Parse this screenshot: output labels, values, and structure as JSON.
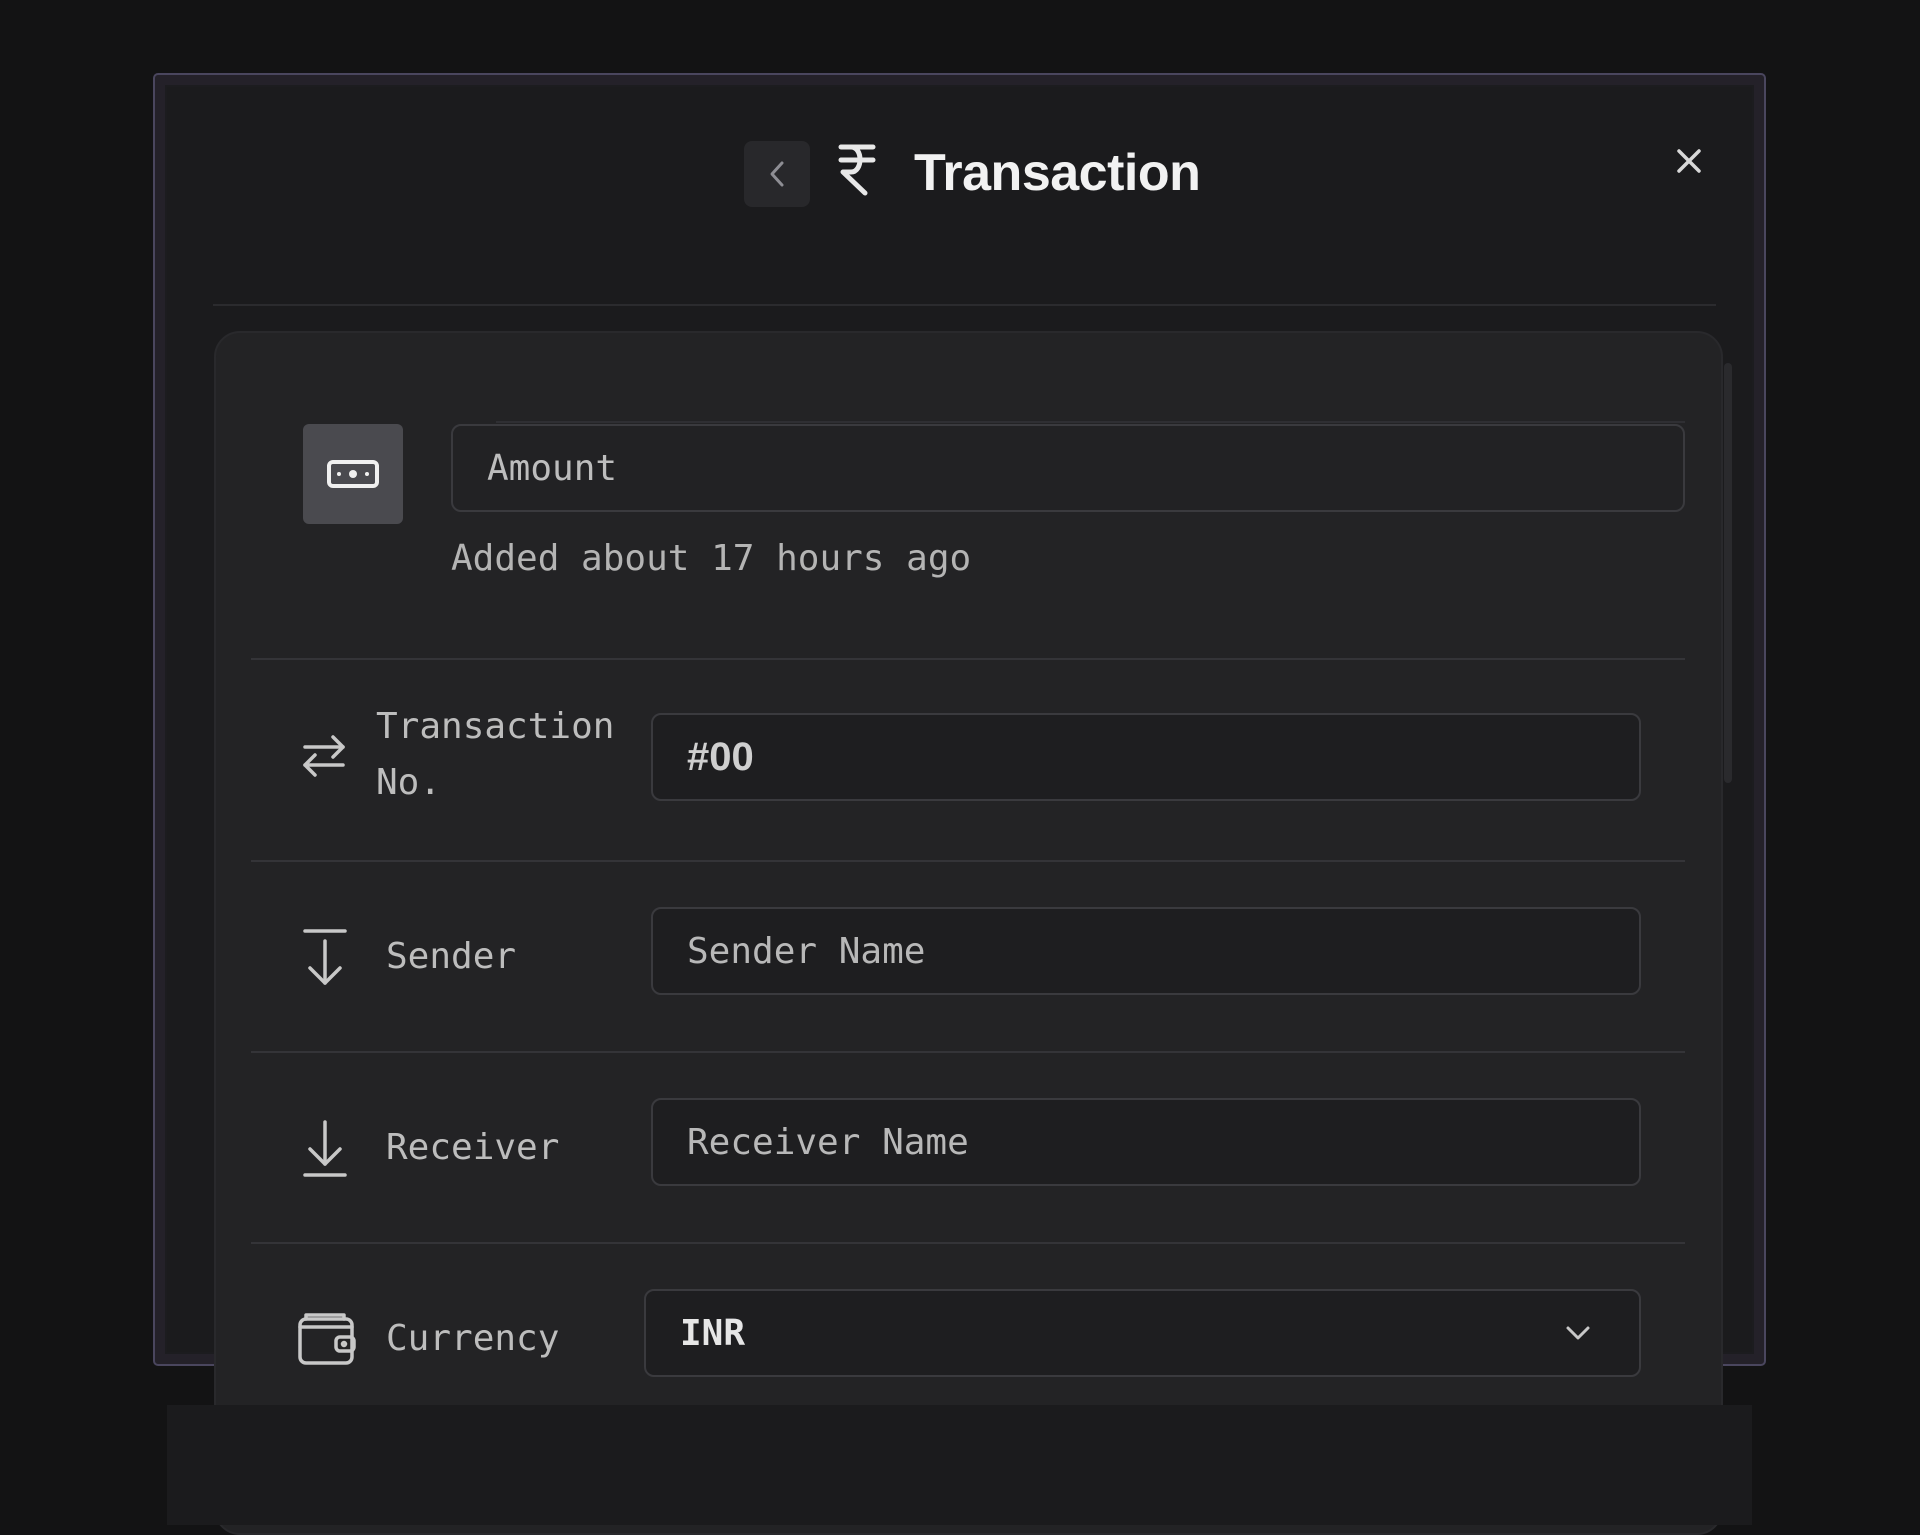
{
  "header": {
    "title": "Transaction",
    "back_icon": "chevron-left-icon",
    "title_icon": "rupee-icon",
    "close_icon": "close-icon"
  },
  "amount": {
    "icon": "banknote-icon",
    "placeholder": "Amount",
    "added_note": "Added about 17 hours ago"
  },
  "rows": {
    "transaction_no": {
      "icon": "swap-arrows-icon",
      "label_line1": "Transaction",
      "label_line2": "No.",
      "value": "#00"
    },
    "sender": {
      "icon": "arrow-down-from-bar-icon",
      "label": "Sender",
      "placeholder": "Sender Name"
    },
    "receiver": {
      "icon": "arrow-down-to-bar-icon",
      "label": "Receiver",
      "placeholder": "Receiver Name"
    },
    "currency": {
      "icon": "wallet-icon",
      "label": "Currency",
      "selected": "INR"
    }
  },
  "colors": {
    "background": "#131314",
    "modal_border": "#4a465e",
    "card": "#232325",
    "text": "#bdbdbd",
    "title": "#f2f2f2"
  }
}
